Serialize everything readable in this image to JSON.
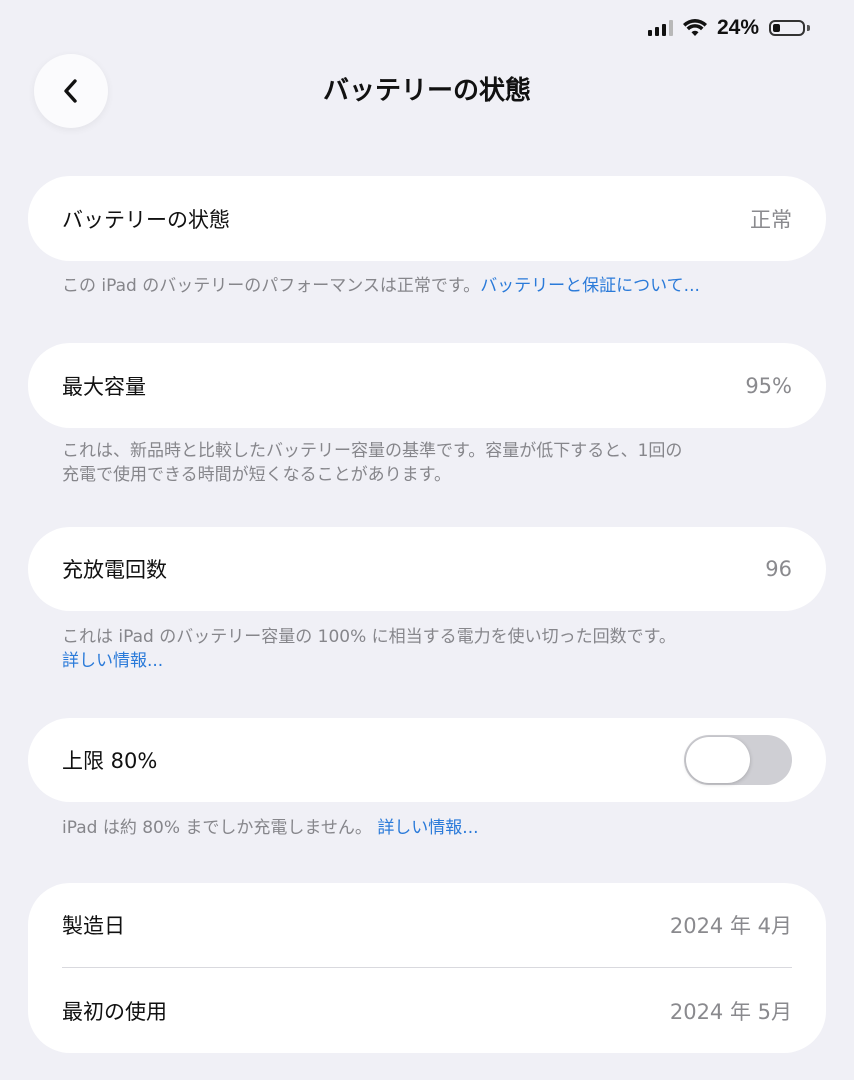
{
  "status_bar": {
    "battery_percent": "24%",
    "battery_level": 0.24
  },
  "nav": {
    "title": "バッテリーの状態"
  },
  "battery_health": {
    "label": "バッテリーの状態",
    "value": "正常",
    "note_text": "この iPad のバッテリーのパフォーマンスは正常です。",
    "note_link": "バッテリーと保証について..."
  },
  "max_capacity": {
    "label": "最大容量",
    "value": "95%",
    "note_line1": "これは、新品時と比較したバッテリー容量の基準です。容量が低下すると、1回の",
    "note_line2": "充電で使用できる時間が短くなることがあります。"
  },
  "cycle_count": {
    "label": "充放電回数",
    "value": "96",
    "note_text": "これは iPad のバッテリー容量の 100% に相当する電力を使い切った回数です。",
    "note_link": "詳しい情報..."
  },
  "limit_80": {
    "label": "上限 80%",
    "toggle_on": false,
    "note_text": "iPad は約 80% までしか充電しません。",
    "note_link": "詳しい情報..."
  },
  "dates": {
    "manufacture_label": "製造日",
    "manufacture_value": "2024 年 4月",
    "first_use_label": "最初の使用",
    "first_use_value": "2024 年 5月"
  }
}
